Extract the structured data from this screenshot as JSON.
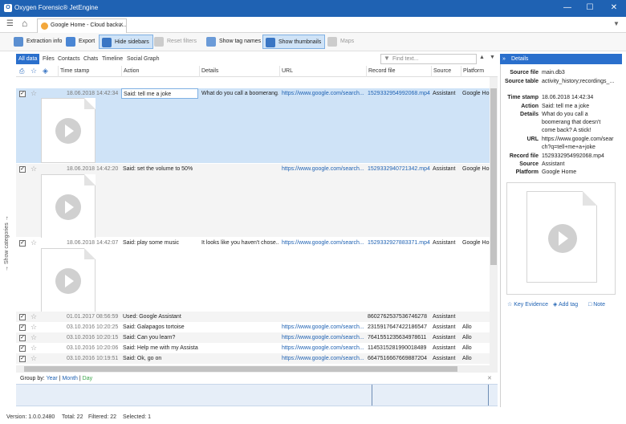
{
  "window": {
    "title": "Oxygen Forensic® JetEngine",
    "logo_text": "O",
    "minimize": "—",
    "maximize": "☐",
    "close": "✕"
  },
  "tabstrip": {
    "menu_icon": "☰",
    "home_icon": "⌂",
    "tab_label": "Google Home - Cloud backu...",
    "tab_close": "✕",
    "filter_icon": "▼"
  },
  "toolbar": {
    "extraction_info": "Extraction info",
    "export": "Export",
    "hide_sidebars": "Hide sidebars",
    "reset_filters": "Reset filters",
    "show_tag_names": "Show tag names",
    "show_thumbnails": "Show thumbnails",
    "maps": "Maps"
  },
  "category_tabs": [
    "All data",
    "Files",
    "Contacts",
    "Chats",
    "Timeline",
    "Social Graph"
  ],
  "filter": {
    "placeholder": "Find text...",
    "up": "▲",
    "down": "▼"
  },
  "columns": {
    "timestamp": "Time stamp",
    "action": "Action",
    "details": "Details",
    "url": "URL",
    "record_file": "Record file",
    "source": "Source",
    "platform": "Platform"
  },
  "rows": [
    {
      "checked": true,
      "timestamp": "18.06.2018 14:42:34",
      "action": "Said: tell me a joke",
      "details": "What do you call a boomerang...",
      "url": "https://www.google.com/search...",
      "record_file": "1529332954992068.mp4",
      "source": "Assistant",
      "platform": "Google Hom"
    },
    {
      "checked": true,
      "timestamp": "18.06.2018 14:42:20",
      "action": "Said: set the volume to 50%",
      "details": "",
      "url": "https://www.google.com/search...",
      "record_file": "1529332940721342.mp4",
      "source": "Assistant",
      "platform": "Google Hom"
    },
    {
      "checked": true,
      "timestamp": "18.06.2018 14:42:07",
      "action": "Said: play some music",
      "details": "It looks like you haven't chose...",
      "url": "https://www.google.com/search...",
      "record_file": "1529332927883371.mp4",
      "source": "Assistant",
      "platform": "Google Hom"
    },
    {
      "checked": true,
      "timestamp": "01.01.2017 08:56:59",
      "action": "Used: Google Assistant",
      "details": "",
      "url": "",
      "record_file": "8602762537536746278",
      "source": "Assistant",
      "platform": ""
    },
    {
      "checked": true,
      "timestamp": "03.10.2016 10:20:25",
      "action": "Said: Galapagos tortoise",
      "details": "",
      "url": "https://www.google.com/search...",
      "record_file": "2315917647422186547",
      "source": "Assistant",
      "platform": "Allo"
    },
    {
      "checked": true,
      "timestamp": "03.10.2016 10:20:15",
      "action": "Said: Can you learn?",
      "details": "",
      "url": "https://www.google.com/search...",
      "record_file": "7641551235634978611",
      "source": "Assistant",
      "platform": "Allo"
    },
    {
      "checked": true,
      "timestamp": "03.10.2016 10:20:06",
      "action": "Said: Help me with my Assistant",
      "details": "",
      "url": "https://www.google.com/search...",
      "record_file": "1145315281990018489",
      "source": "Assistant",
      "platform": "Allo"
    },
    {
      "checked": true,
      "timestamp": "03.10.2016 10:19:51",
      "action": "Said: Ok, go on",
      "details": "",
      "url": "https://www.google.com/search...",
      "record_file": "6647516667669887204",
      "source": "Assistant",
      "platform": "Allo"
    }
  ],
  "sidebar": {
    "show_categories": "→ Show categories →"
  },
  "groupby": {
    "label": "Group by:",
    "year": "Year",
    "month": "Month",
    "day": "Day",
    "sep": "|"
  },
  "details": {
    "header": "Details",
    "fields": [
      {
        "key": "Source file",
        "value": "main.db3",
        "link": true
      },
      {
        "key": "Source table",
        "value": "activity_history;recordings_...",
        "link": false
      },
      {
        "key": "Time stamp",
        "value": "18.06.2018 14:42:34",
        "link": false
      },
      {
        "key": "Action",
        "value": "Said: tell me a joke",
        "link": false
      },
      {
        "key": "Details",
        "value": "What do you call a boomerang that doesn't come back? A stick!",
        "link": false
      },
      {
        "key": "URL",
        "value": "https://www.google.com/search?q=tell+me+a+joke",
        "link": true
      },
      {
        "key": "Record file",
        "value": "1529332954992068.mp4",
        "link": true
      },
      {
        "key": "Source",
        "value": "Assistant",
        "link": false
      },
      {
        "key": "Platform",
        "value": "Google Home",
        "link": false
      }
    ],
    "key_evidence": "Key Evidence",
    "add_tag": "Add tag",
    "note": "Note"
  },
  "status": {
    "version": "Version: 1.0.0.2480",
    "total": "Total: 22",
    "filtered": "Filtered: 22",
    "selected": "Selected: 1"
  },
  "colors": {
    "accent": "#1f62b3",
    "selection": "#cfe3f7",
    "active_tab": "#2a6fcc"
  }
}
